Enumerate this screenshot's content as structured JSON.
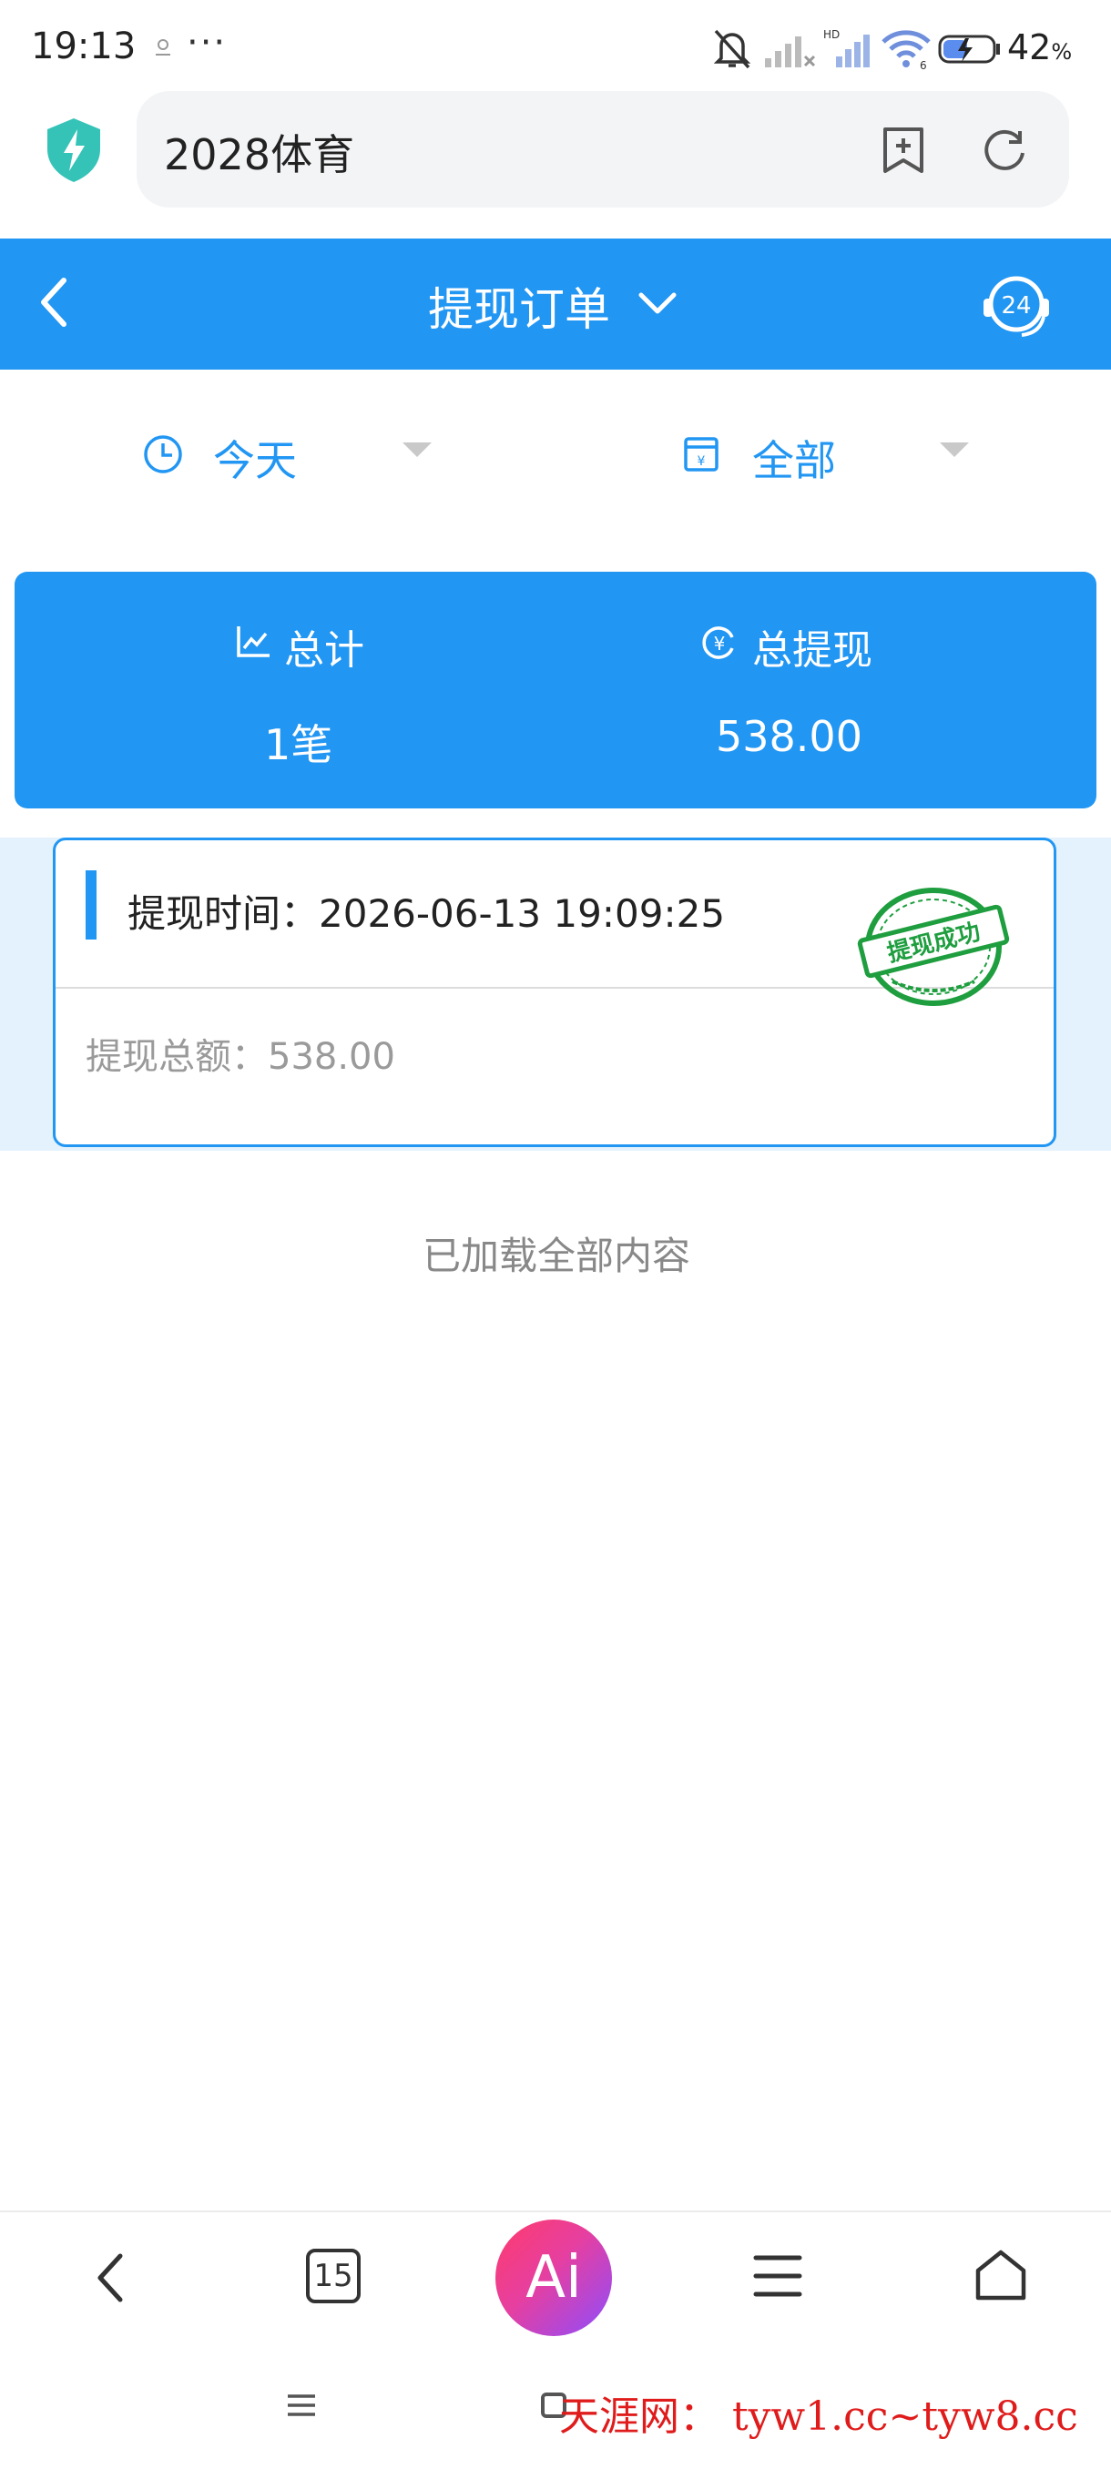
{
  "status_bar": {
    "time": "19:13",
    "dots": "···",
    "battery_percent": "42",
    "battery_unit": "%"
  },
  "browser": {
    "address": "2028体育",
    "icons": [
      "shield-icon",
      "bookmark-add-icon",
      "refresh-icon"
    ]
  },
  "header": {
    "title": "提现订单",
    "icons": [
      "back-icon",
      "chevron-down-icon",
      "support-24-icon"
    ],
    "support_badge": "24"
  },
  "filters": {
    "date_label": "今天",
    "type_label": "全部"
  },
  "summary": {
    "total_label": "总计",
    "total_value": "1笔",
    "withdraw_label": "总提现",
    "withdraw_value": "538.00"
  },
  "orders": [
    {
      "time_label": "提现时间：2026-06-13 19:09:25",
      "amount_label": "提现总额：538.00",
      "status_stamp": "提现成功"
    }
  ],
  "list_footer": "已加载全部内容",
  "bottom_toolbar": {
    "tabs_count": "15",
    "ai_label": "Ai"
  },
  "watermark": "天涯网： tyw1.cc~tyw8.cc",
  "colors": {
    "primary": "#2196f3",
    "stamp_green": "#1e9e3e",
    "watermark_red": "#e01b1b"
  }
}
